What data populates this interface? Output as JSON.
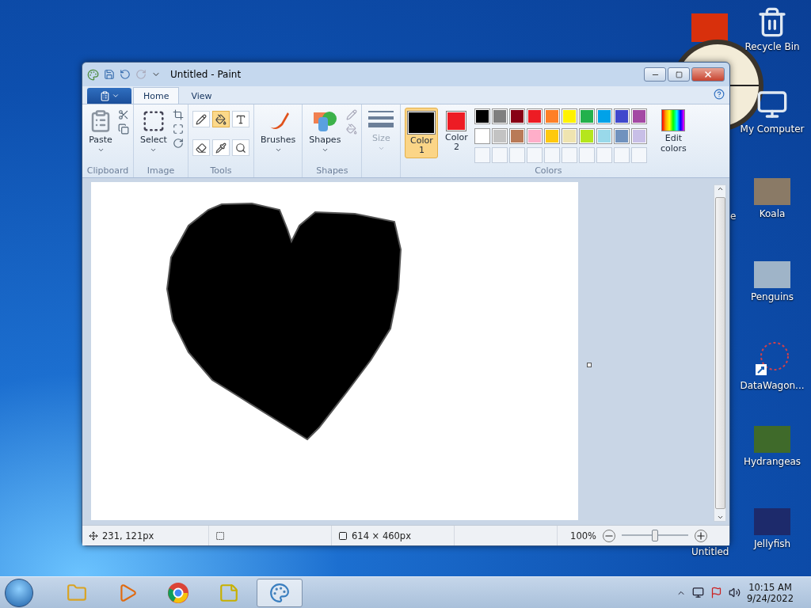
{
  "window": {
    "title": "Untitled - Paint"
  },
  "tabs": [
    {
      "label": "Home",
      "selected": true
    },
    {
      "label": "View",
      "selected": false
    }
  ],
  "ribbon": {
    "clipboard": {
      "label": "Clipboard",
      "paste": "Paste"
    },
    "image": {
      "label": "Image",
      "select": "Select"
    },
    "tools": {
      "label": "Tools",
      "items": [
        {
          "kind": "pencil",
          "selected": false
        },
        {
          "kind": "fill",
          "selected": true
        },
        {
          "kind": "text",
          "selected": false
        },
        {
          "kind": "eraser",
          "selected": false
        },
        {
          "kind": "picker",
          "selected": false
        },
        {
          "kind": "magnifier",
          "selected": false
        }
      ]
    },
    "brushes": {
      "label": "Brushes"
    },
    "shapes": {
      "label": "Shapes",
      "button": "Shapes"
    },
    "size": {
      "label": "Size",
      "disabled": true
    },
    "colors": {
      "label": "Colors",
      "edit": "Edit colors",
      "current": [
        {
          "label": "Color 1",
          "color": "#000000",
          "selected": true
        },
        {
          "label": "Color 2",
          "color": "#ed1c24",
          "selected": false
        }
      ],
      "palette": [
        {
          "color": "#000000"
        },
        {
          "color": "#7f7f7f"
        },
        {
          "color": "#880015"
        },
        {
          "color": "#ed1c24"
        },
        {
          "color": "#ff7f27"
        },
        {
          "color": "#fff200"
        },
        {
          "color": "#22b14c"
        },
        {
          "color": "#00a2e8"
        },
        {
          "color": "#3f48cc"
        },
        {
          "color": "#a349a4"
        },
        {
          "color": "#ffffff"
        },
        {
          "color": "#c3c3c3"
        },
        {
          "color": "#b97a57"
        },
        {
          "color": "#ffaec9"
        },
        {
          "color": "#ffc90e"
        },
        {
          "color": "#efe4b0"
        },
        {
          "color": "#b5e61d"
        },
        {
          "color": "#99d9ea"
        },
        {
          "color": "#7092be"
        },
        {
          "color": "#c8bfe7"
        }
      ]
    }
  },
  "status_bar": {
    "position": "231, 121px",
    "size": "614 × 460px",
    "zoom": "100%",
    "zoom_slider": {
      "level": 0.5
    }
  },
  "desktop_icons": [
    {
      "label": "Recycle Bin",
      "kind": "bin"
    },
    {
      "label": "My Computer",
      "kind": "computer"
    },
    {
      "label": "Koala",
      "kind": "photo",
      "color": "#8a7a66"
    },
    {
      "label": "e",
      "kind": "partial"
    },
    {
      "label": "Penguins",
      "kind": "photo",
      "color": "#9fb4c8"
    },
    {
      "label": "DataWagon...",
      "kind": "shortcut"
    },
    {
      "label": "Hydrangeas",
      "kind": "photo",
      "color": "#3f6a2a"
    },
    {
      "label": "Jellyfish",
      "kind": "photo",
      "color": "#1d2a6b"
    },
    {
      "label": "Untitled",
      "kind": "partial"
    }
  ],
  "taskbar": {
    "apps": [
      {
        "kind": "explorer",
        "selected": false
      },
      {
        "kind": "media",
        "selected": false
      },
      {
        "kind": "chrome",
        "selected": false
      },
      {
        "kind": "notes",
        "selected": false
      },
      {
        "kind": "paint",
        "selected": true
      }
    ],
    "time": "10:15 AM",
    "date": "9/24/2022"
  }
}
